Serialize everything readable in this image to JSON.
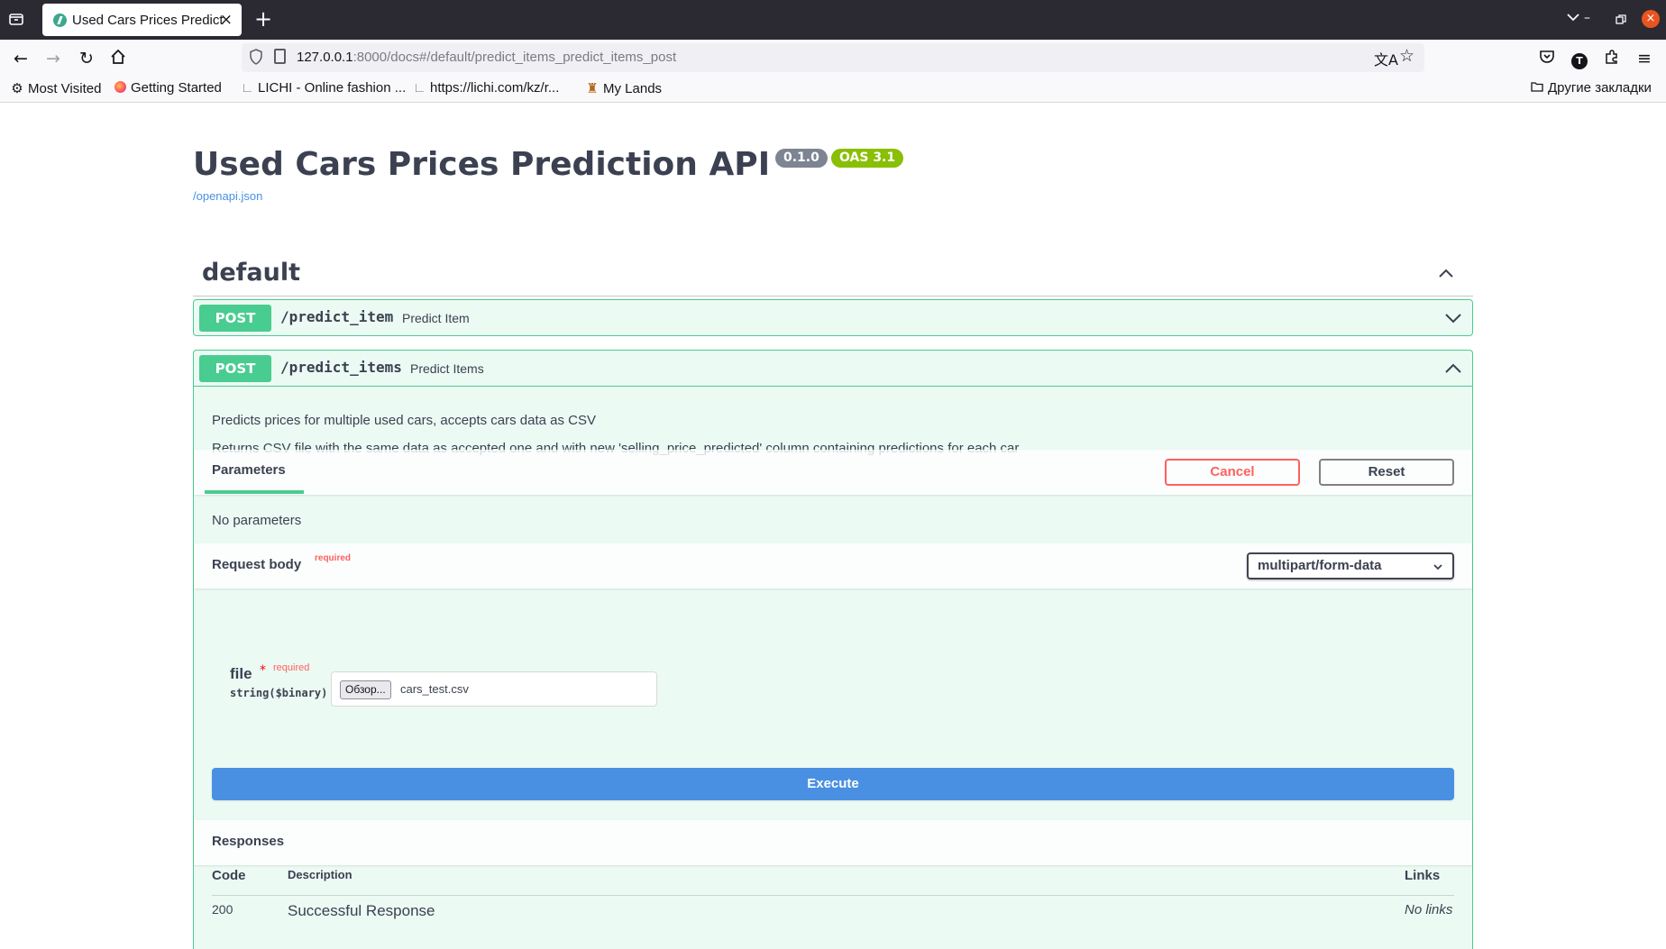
{
  "browser": {
    "tab_title": "Used Cars Prices Predict",
    "url_host": "127.0.0.1",
    "url_rest": ":8000/docs#/default/predict_items_predict_items_post",
    "bookmarks": [
      {
        "label": "Most Visited",
        "icon": "gear-icon"
      },
      {
        "label": "Getting Started",
        "icon": "firefox-icon"
      },
      {
        "label": "LICHI - Online fashion ...",
        "icon": "page-icon"
      },
      {
        "label": "https://lichi.com/kz/r...",
        "icon": "page-icon"
      },
      {
        "label": "My Lands",
        "icon": "game-icon"
      }
    ],
    "other_bookmarks": "Другие закладки",
    "profile_initial": "T"
  },
  "info": {
    "title": "Used Cars Prices Prediction API",
    "version": "0.1.0",
    "oas": "OAS 3.1",
    "openapi_link": "/openapi.json"
  },
  "tag": {
    "name": "default"
  },
  "operations": [
    {
      "method": "POST",
      "path": "/predict_item",
      "summary": "Predict Item",
      "expanded": false
    },
    {
      "method": "POST",
      "path": "/predict_items",
      "summary": "Predict Items",
      "expanded": true
    }
  ],
  "op_detail": {
    "description_lines": [
      "Predicts prices for multiple used cars, accepts cars data as CSV",
      "Returns CSV file with the same data as accepted one and with new 'selling_price_predicted' column containing predictions for each car"
    ],
    "parameters_tab": "Parameters",
    "cancel_label": "Cancel",
    "reset_label": "Reset",
    "no_parameters": "No parameters",
    "request_body_label": "Request body",
    "required_label": "required",
    "content_type": "multipart/form-data",
    "file_field": {
      "name": "file",
      "star": "*",
      "required": "required",
      "type": "string($binary)",
      "browse_label": "Обзор...",
      "file_name": "cars_test.csv"
    },
    "execute_label": "Execute",
    "responses_label": "Responses",
    "responses_table": {
      "headers": {
        "code": "Code",
        "description": "Description",
        "links": "Links"
      },
      "rows": [
        {
          "code": "200",
          "description": "Successful Response",
          "links": "No links"
        }
      ]
    }
  },
  "colors": {
    "post": "#49cc90",
    "execute": "#4990e2",
    "cancel": "#ff6060",
    "oas_badge": "#89bf04",
    "version_badge": "#7d8492"
  }
}
